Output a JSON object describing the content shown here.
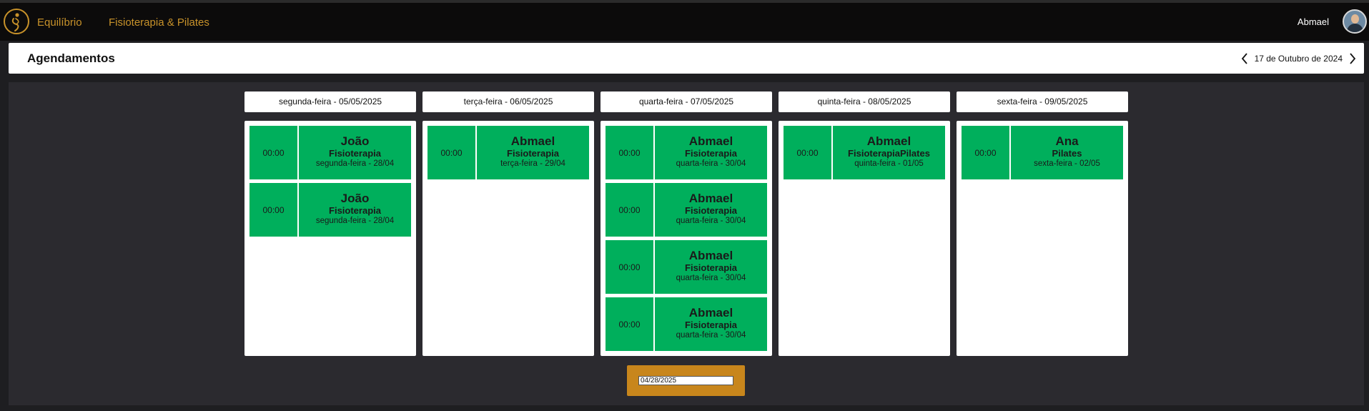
{
  "navbar": {
    "brand": "Equilíbrio",
    "link": "Fisioterapia & Pilates",
    "user_name": "Abmael"
  },
  "header": {
    "title": "Agendamentos",
    "current_date": "17 de Outubro de 2024",
    "prev_icon": "chevron-left-icon",
    "next_icon": "chevron-right-icon"
  },
  "colors": {
    "accent": "#c8922a",
    "appointment": "#00af5c",
    "date_box": "#c8861c",
    "background": "#1e1e21"
  },
  "days": [
    {
      "label": "segunda-feira - 05/05/2025",
      "appointments": [
        {
          "time": "00:00",
          "name": "João",
          "service": "Fisioterapia",
          "origin": "segunda-feira - 28/04"
        },
        {
          "time": "00:00",
          "name": "João",
          "service": "Fisioterapia",
          "origin": "segunda-feira - 28/04"
        }
      ]
    },
    {
      "label": "terça-feira - 06/05/2025",
      "appointments": [
        {
          "time": "00:00",
          "name": "Abmael",
          "service": "Fisioterapia",
          "origin": "terça-feira - 29/04"
        }
      ]
    },
    {
      "label": "quarta-feira - 07/05/2025",
      "appointments": [
        {
          "time": "00:00",
          "name": "Abmael",
          "service": "Fisioterapia",
          "origin": "quarta-feira - 30/04"
        },
        {
          "time": "00:00",
          "name": "Abmael",
          "service": "Fisioterapia",
          "origin": "quarta-feira - 30/04"
        },
        {
          "time": "00:00",
          "name": "Abmael",
          "service": "Fisioterapia",
          "origin": "quarta-feira - 30/04"
        },
        {
          "time": "00:00",
          "name": "Abmael",
          "service": "Fisioterapia",
          "origin": "quarta-feira - 30/04"
        }
      ]
    },
    {
      "label": "quinta-feira - 08/05/2025",
      "appointments": [
        {
          "time": "00:00",
          "name": "Abmael",
          "service": "FisioterapiaPilates",
          "origin": "quinta-feira - 01/05"
        }
      ]
    },
    {
      "label": "sexta-feira - 09/05/2025",
      "appointments": [
        {
          "time": "00:00",
          "name": "Ana",
          "service": "Pilates",
          "origin": "sexta-feira - 02/05"
        }
      ]
    }
  ],
  "date_picker": {
    "value": "04/28/2025"
  }
}
